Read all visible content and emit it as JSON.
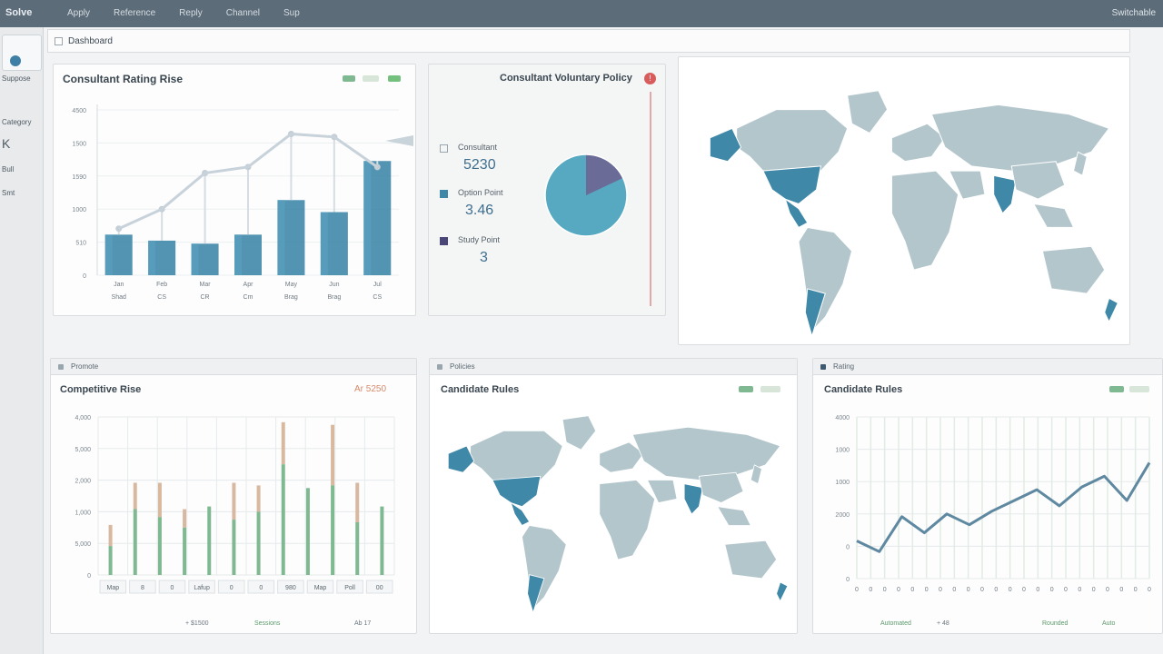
{
  "topbar": {
    "brand": "Solve",
    "nav": [
      "Apply",
      "Reference",
      "Reply",
      "Channel",
      "Sup"
    ],
    "user": "Switchable"
  },
  "sidebar": {
    "items": [
      "Suppose",
      "Category",
      "K",
      "Bull",
      "Smt"
    ]
  },
  "subbar": {
    "title": "Dashboard"
  },
  "colors": {
    "bar": "#3f88a8",
    "line": "#c8d2da",
    "map_land": "#b3c6cc",
    "map_highlight": "#3f88a8",
    "pie_main": "#57a9c1",
    "pie_slice": "#6a6b97",
    "green_bar": "#7fb991",
    "tan_bar": "#d8b9a0",
    "line_series": "#5f88a1",
    "accent_red": "#d85c5c"
  },
  "card1": {
    "title": "Consultant Rating Rise",
    "chart_data": {
      "type": "bar",
      "title": "Consultant Rating Rise",
      "categories": [
        "Jan",
        "Feb",
        "Mar",
        "Apr",
        "May",
        "Jun",
        "Jul"
      ],
      "category_sub": [
        "Shad",
        "CS",
        "CR",
        "Cm",
        "Brag",
        "Brag",
        "CS"
      ],
      "yticks": [
        "0",
        "510",
        "1000",
        "1590",
        "1500",
        "4500"
      ],
      "ylim": [
        0,
        5500
      ],
      "series": [
        {
          "type": "bar",
          "values": [
            1350,
            1150,
            1050,
            1350,
            2500,
            2100,
            3800
          ]
        },
        {
          "type": "line",
          "values": [
            1550,
            2200,
            3400,
            3600,
            4700,
            4600,
            3600
          ]
        }
      ]
    }
  },
  "card2": {
    "title": "Consultant Voluntary Policy",
    "stats": [
      {
        "label": "Consultant",
        "value": "5230",
        "swatch": "#ffffff"
      },
      {
        "label": "Option Point",
        "value": "3.46",
        "swatch": "#3f88a8"
      },
      {
        "label": "Study Point",
        "value": "3",
        "swatch": "#4a4778"
      }
    ],
    "chart_data": {
      "type": "pie",
      "values": [
        82,
        18
      ]
    }
  },
  "card4": {
    "head": "Promote",
    "title": "Competitive Rise",
    "badge": "Ar 5250",
    "chart_data": {
      "type": "bar",
      "title": "Competitive Rise",
      "categories": [
        "Map",
        "8",
        "0",
        "Lafup",
        "0",
        "0",
        "980",
        "Map",
        "Poll",
        "00"
      ],
      "yticks": [
        "0",
        "5,000",
        "1,000",
        "2,000",
        "5,000",
        "4,000"
      ],
      "ylim": [
        0,
        6000
      ],
      "series": [
        {
          "color": "green",
          "values": [
            1100,
            2500,
            2200,
            1800,
            2600,
            2100,
            2400,
            4200,
            3300,
            3400,
            2000,
            2600
          ]
        },
        {
          "color": "tan",
          "values": [
            1900,
            3500,
            3500,
            2500,
            0,
            3500,
            3400,
            5800,
            0,
            5700,
            3500,
            0
          ]
        }
      ]
    },
    "footer": [
      "+ $1500",
      "Sessions",
      "Ab 17"
    ]
  },
  "card5": {
    "head": "Policies",
    "title": "Candidate Rules"
  },
  "card6": {
    "head": "Rating",
    "title": "Candidate Rules",
    "chart_data": {
      "type": "line",
      "title": "Candidate Rules",
      "yticks": [
        "0",
        "0",
        "2000",
        "1000",
        "1000",
        "4000"
      ],
      "ylim": [
        0,
        6000
      ],
      "x": [
        0,
        1,
        2,
        3,
        4,
        5,
        6,
        7,
        8,
        9,
        10,
        11,
        12
      ],
      "values": [
        1400,
        1000,
        2300,
        1700,
        2400,
        2000,
        2500,
        2900,
        3300,
        2700,
        3400,
        3800,
        2900,
        4300
      ],
      "x_tick_count": 22
    },
    "footer": [
      "Automated",
      "+ 48",
      "Rounded",
      "Auto"
    ]
  }
}
